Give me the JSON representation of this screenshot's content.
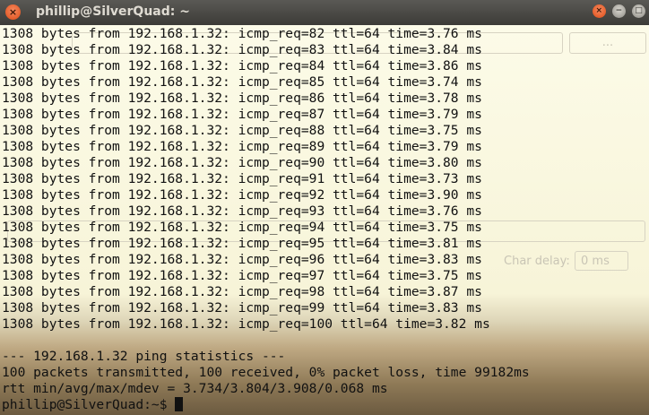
{
  "window": {
    "title": "phillip@SilverQuad: ~",
    "close_glyph": "×",
    "minimize_glyph": "−",
    "maximize_glyph": "□"
  },
  "terminal": {
    "ping_lines": [
      "1308 bytes from 192.168.1.32: icmp_req=82 ttl=64 time=3.76 ms",
      "1308 bytes from 192.168.1.32: icmp_req=83 ttl=64 time=3.84 ms",
      "1308 bytes from 192.168.1.32: icmp_req=84 ttl=64 time=3.86 ms",
      "1308 bytes from 192.168.1.32: icmp_req=85 ttl=64 time=3.74 ms",
      "1308 bytes from 192.168.1.32: icmp_req=86 ttl=64 time=3.78 ms",
      "1308 bytes from 192.168.1.32: icmp_req=87 ttl=64 time=3.79 ms",
      "1308 bytes from 192.168.1.32: icmp_req=88 ttl=64 time=3.75 ms",
      "1308 bytes from 192.168.1.32: icmp_req=89 ttl=64 time=3.79 ms",
      "1308 bytes from 192.168.1.32: icmp_req=90 ttl=64 time=3.80 ms",
      "1308 bytes from 192.168.1.32: icmp_req=91 ttl=64 time=3.73 ms",
      "1308 bytes from 192.168.1.32: icmp_req=92 ttl=64 time=3.90 ms",
      "1308 bytes from 192.168.1.32: icmp_req=93 ttl=64 time=3.76 ms",
      "1308 bytes from 192.168.1.32: icmp_req=94 ttl=64 time=3.75 ms",
      "1308 bytes from 192.168.1.32: icmp_req=95 ttl=64 time=3.81 ms",
      "1308 bytes from 192.168.1.32: icmp_req=96 ttl=64 time=3.83 ms",
      "1308 bytes from 192.168.1.32: icmp_req=97 ttl=64 time=3.75 ms",
      "1308 bytes from 192.168.1.32: icmp_req=98 ttl=64 time=3.87 ms",
      "1308 bytes from 192.168.1.32: icmp_req=99 ttl=64 time=3.83 ms",
      "1308 bytes from 192.168.1.32: icmp_req=100 ttl=64 time=3.82 ms"
    ],
    "stats_header": "--- 192.168.1.32 ping statistics ---",
    "stats_summary": "100 packets transmitted, 100 received, 0% packet loss, time 99182ms",
    "stats_rtt": "rtt min/avg/max/mdev = 3.734/3.804/3.908/0.068 ms",
    "prompt": "phillip@SilverQuad:~$ "
  },
  "background_window": {
    "button_label": "...",
    "char_delay_label": "Char delay:",
    "char_delay_value": "0 ms"
  }
}
